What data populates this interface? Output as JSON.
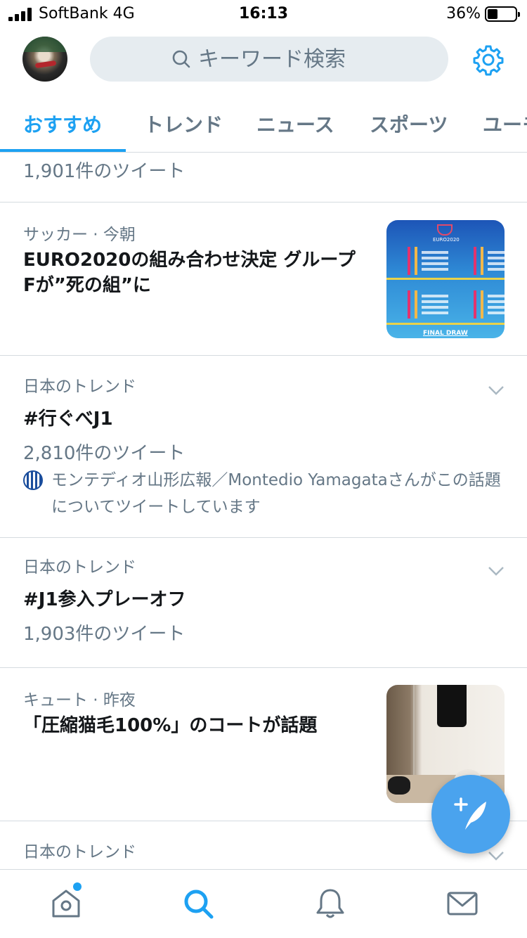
{
  "status_bar": {
    "carrier": "SoftBank 4G",
    "time": "16:13",
    "battery": "36%",
    "battery_level": 0.36
  },
  "header": {
    "search_placeholder": "キーワード検索"
  },
  "tabs": [
    {
      "label": "おすすめ",
      "active": true
    },
    {
      "label": "トレンド",
      "active": false
    },
    {
      "label": "ニュース",
      "active": false
    },
    {
      "label": "スポーツ",
      "active": false
    },
    {
      "label": "ユーモ",
      "active": false
    }
  ],
  "feed": {
    "partial_item": {
      "count": "1,901件のツイート"
    },
    "items": [
      {
        "meta": "サッカー · 今朝",
        "title": "EURO2020の組み合わせ決定 グループFが”死の組”に",
        "thumbnail": {
          "small_text": "FINAL DRAW",
          "top_text": "EURO2020"
        }
      },
      {
        "meta": "日本のトレンド",
        "title": "#行ぐべJ1",
        "count": "2,810件のツイート",
        "context": "モンテディオ山形広報／Montedio Yamagataさんがこの話題についてツイートしています"
      },
      {
        "meta": "日本のトレンド",
        "title": "#J1参入プレーオフ",
        "count": "1,903件のツイート"
      },
      {
        "meta": "キュート · 昨夜",
        "title": "「圧縮猫毛100%」のコートが話題"
      },
      {
        "meta": "日本のトレンド"
      }
    ]
  },
  "colors": {
    "accent": "#1da1f2",
    "secondary_text": "#657786",
    "primary_text": "#14171a",
    "fab": "#4aa3ee"
  },
  "icons": {
    "settings": "gear-icon",
    "search": "search-icon",
    "home": "home-icon",
    "explore": "search-icon",
    "notifications": "bell-icon",
    "messages": "mail-icon",
    "compose": "compose-feather-icon",
    "chevron": "chevron-down-icon"
  }
}
